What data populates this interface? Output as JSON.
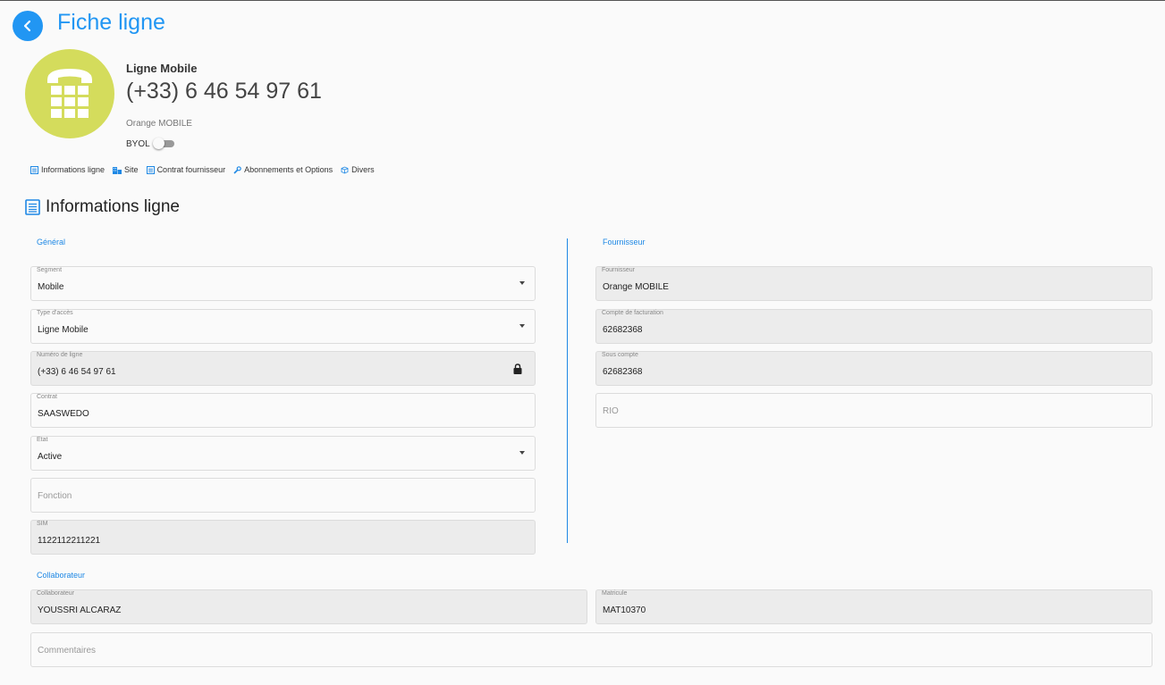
{
  "header": {
    "title": "Fiche ligne"
  },
  "profile": {
    "type": "Ligne Mobile",
    "number": "(+33) 6 46 54 97 61",
    "operator": "Orange MOBILE",
    "byol_label": "BYOL",
    "byol_on": false
  },
  "tabs": [
    {
      "label": "Informations ligne",
      "icon": "list-icon"
    },
    {
      "label": "Site",
      "icon": "building-icon"
    },
    {
      "label": "Contrat fournisseur",
      "icon": "document-icon"
    },
    {
      "label": "Abonnements et Options",
      "icon": "wrench-icon"
    },
    {
      "label": "Divers",
      "icon": "box-icon"
    }
  ],
  "section": {
    "title": "Informations ligne"
  },
  "general": {
    "label": "Général",
    "segment": {
      "label": "Segment",
      "value": "Mobile"
    },
    "type_acces": {
      "label": "Type d'accès",
      "value": "Ligne Mobile"
    },
    "numero": {
      "label": "Numéro de ligne",
      "value": "(+33) 6 46 54 97 61"
    },
    "contrat": {
      "label": "Contrat",
      "value": "SAASWEDO"
    },
    "etat": {
      "label": "Etat",
      "value": "Active"
    },
    "fonction": {
      "placeholder": "Fonction"
    },
    "sim": {
      "label": "SIM",
      "value": "1122112211221"
    }
  },
  "fournisseur": {
    "label": "Fournisseur",
    "fournisseur": {
      "label": "Fournisseur",
      "value": "Orange MOBILE"
    },
    "compte": {
      "label": "Compte de facturation",
      "value": "62682368"
    },
    "sous_compte": {
      "label": "Sous compte",
      "value": "62682368"
    },
    "rio": {
      "placeholder": "RIO"
    }
  },
  "collaborateur": {
    "label": "Collaborateur",
    "collaborateur": {
      "label": "Collaborateur",
      "value": "YOUSSRI ALCARAZ"
    },
    "matricule": {
      "label": "Matricule",
      "value": "MAT10370"
    },
    "commentaires": {
      "placeholder": "Commentaires"
    }
  },
  "colors": {
    "accent": "#2196f3",
    "avatar": "#d4dc5c"
  }
}
